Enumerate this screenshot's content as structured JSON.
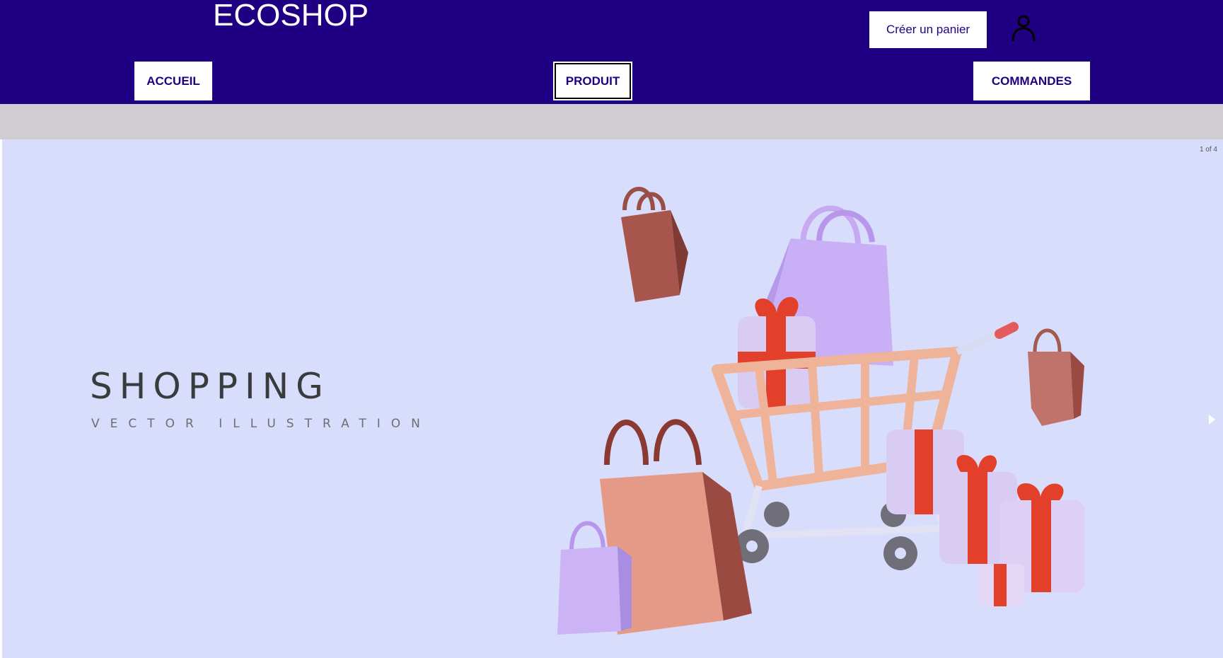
{
  "header": {
    "logo": "ECOSHOP",
    "cart_button": "Créer un panier",
    "user_icon": "user-icon"
  },
  "nav": {
    "items": [
      {
        "label": "ACCUEIL",
        "active": false
      },
      {
        "label": "PRODUIT",
        "active": true
      },
      {
        "label": "COMMANDES",
        "active": false
      }
    ]
  },
  "carousel": {
    "counter": "1 of 4",
    "title": "SHOPPING",
    "subtitle": "VECTOR ILLUSTRATION",
    "next_icon": "chevron-right-icon",
    "image": "shopping-cart-bags-gifts-illustration"
  },
  "colors": {
    "header_bg": "#1f0083",
    "accent_text": "#1f0083",
    "hero_bg": "#d8ddfb",
    "divider_bar": "#cfcdd2"
  }
}
